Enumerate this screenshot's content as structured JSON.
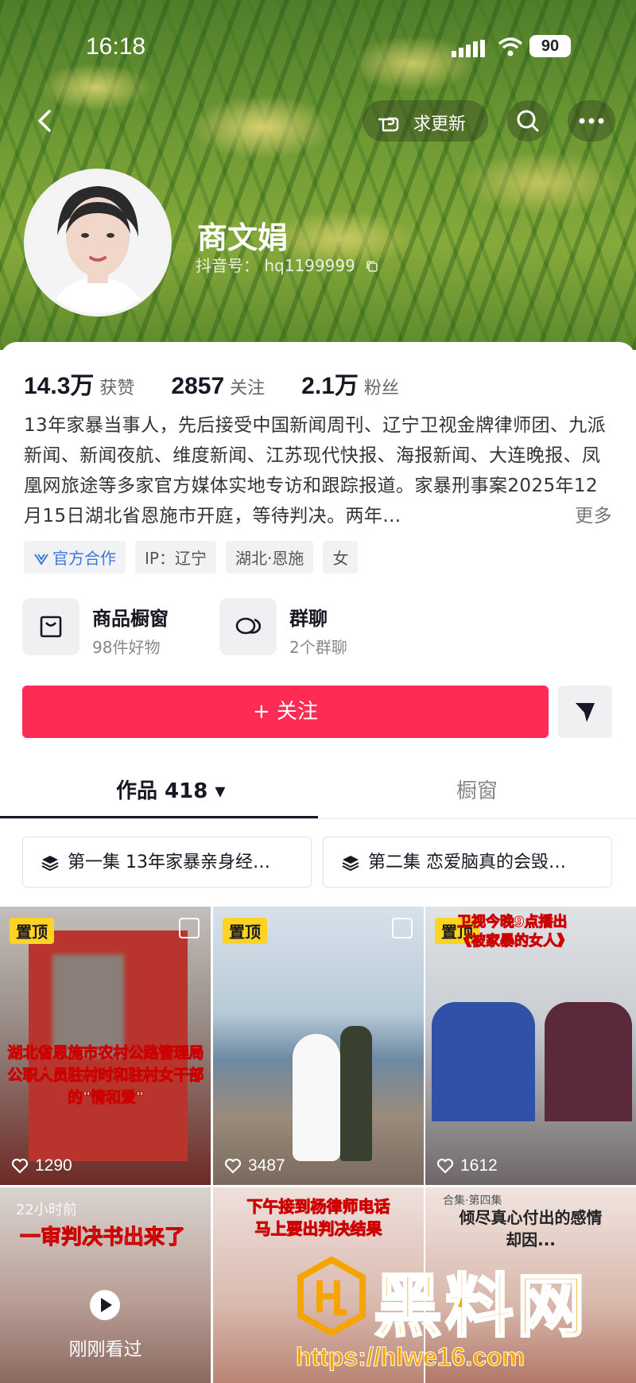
{
  "status_bar": {
    "time": "16:18",
    "battery": "90"
  },
  "header": {
    "update_label": "求更新"
  },
  "profile": {
    "name": "商文娟",
    "douyin_id": "抖音号： hq1199999"
  },
  "stats": [
    {
      "value": "14.3万",
      "label": "获赞"
    },
    {
      "value": "2857",
      "label": "关注"
    },
    {
      "value": "2.1万",
      "label": "粉丝"
    }
  ],
  "bio": {
    "text": "13年家暴当事人，先后接受中国新闻周刊、辽宁卫视金牌律师团、九派新闻、新闻夜航、维度新闻、江苏现代快报、海报新闻、大连晚报、凤凰网旅途等多家官方媒体实地专访和跟踪报道。家暴刑事案2025年12月15日湖北省恩施市开庭，等待判决。两年…",
    "more": "更多"
  },
  "tags": [
    "官方合作",
    "IP：辽宁",
    "湖北·恩施",
    "女"
  ],
  "features": [
    {
      "title": "商品橱窗",
      "sub": "98件好物"
    },
    {
      "title": "群聊",
      "sub": "2个群聊"
    }
  ],
  "follow_label": "+ 关注",
  "tabs": [
    {
      "label": "作品 418 ▾"
    },
    {
      "label": "橱窗"
    }
  ],
  "collections": [
    "第一集  13年家暴亲身经…",
    "第二集  恋爱脑真的会毁…"
  ],
  "videos": [
    {
      "pinned": "置顶",
      "likes": "1290",
      "overlay": "湖北省恩施市农村公路管理局\n公职人员驻村时和驻村女干部的\"情和爱\""
    },
    {
      "pinned": "置顶",
      "likes": "3487",
      "overlay": ""
    },
    {
      "pinned": "置顶",
      "likes": "1612",
      "overlay": "卫视今晚9点播出\n《被家暴的女人》"
    },
    {
      "top": "22小时前",
      "overlay": "一审判决书出来了",
      "seen": "刚刚看过"
    },
    {
      "overlay": "下午接到杨律师电话\n马上要出判决结果"
    },
    {
      "top": "合集·第四集",
      "overlay": "倾尽真心付出的感情\n却因..."
    }
  ],
  "watermark": {
    "brand": "黑料网",
    "url": "https://hlwe16.com"
  },
  "colors": {
    "follow": "#fe2c55",
    "pin": "#ffd322",
    "watermark": "#f5a400"
  }
}
